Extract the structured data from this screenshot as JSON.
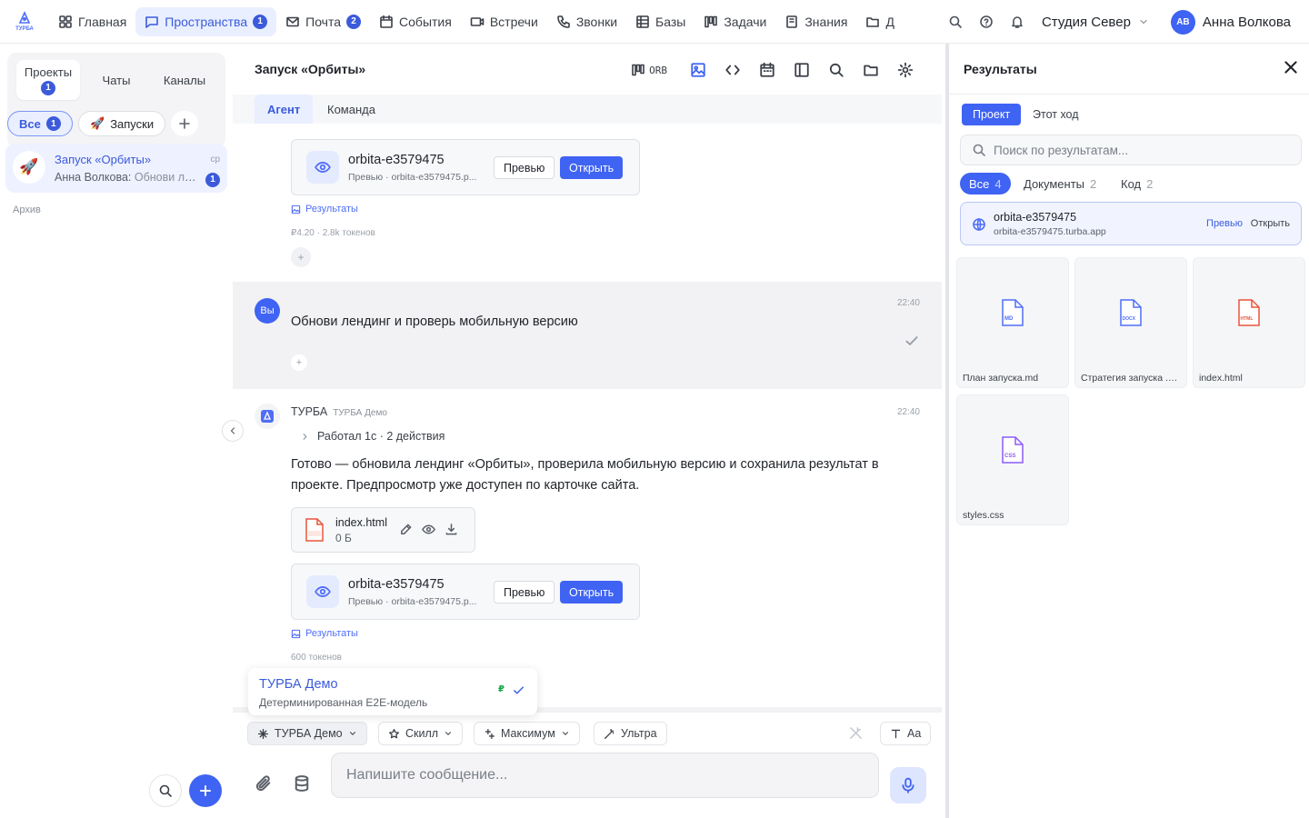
{
  "nav": {
    "logo_text": "ТУРБА",
    "items": [
      {
        "label": "Главная",
        "icon": "grid-icon"
      },
      {
        "label": "Пространства",
        "icon": "chat-icon",
        "badge": "1",
        "active": true
      },
      {
        "label": "Почта",
        "icon": "mail-icon",
        "badge": "2"
      },
      {
        "label": "События",
        "icon": "calendar-icon"
      },
      {
        "label": "Встречи",
        "icon": "video-icon"
      },
      {
        "label": "Звонки",
        "icon": "phone-icon"
      },
      {
        "label": "Базы",
        "icon": "table-icon"
      },
      {
        "label": "Задачи",
        "icon": "kanban-icon"
      },
      {
        "label": "Знания",
        "icon": "book-icon"
      },
      {
        "label": "Д",
        "icon": "folder-icon"
      }
    ],
    "workspace": "Студия Север",
    "user_initials": "АВ",
    "user_name": "Анна Волкова"
  },
  "sidebar": {
    "tabs": [
      {
        "label": "Проекты",
        "badge": "1"
      },
      {
        "label": "Чаты"
      },
      {
        "label": "Каналы"
      }
    ],
    "filters": {
      "all": "Все",
      "all_badge": "1",
      "launches": "Запуски",
      "launch_emoji": "🚀"
    },
    "project": {
      "emoji": "🚀",
      "title": "Запуск «Орбиты»",
      "author": "Анна Волкова:",
      "preview": "Обнови лендинг и проверь мобильную версию",
      "day": "ср",
      "badge": "1"
    },
    "archive": "Архив"
  },
  "main": {
    "title": "Запуск «Орбиты»",
    "orb_label": "ORB",
    "tabs": [
      "Агент",
      "Команда"
    ],
    "card_top": {
      "name": "orbita-e3579475",
      "sub": "Превью · orbita-e3579475.p...",
      "preview": "Превью",
      "open": "Открыть"
    },
    "results_link": "Результаты",
    "meta_top": "₽4.20 · 2.8k токенов",
    "user_msg": {
      "avatar": "Вы",
      "text": "Обнови лендинг и проверь мобильную версию",
      "time": "22:40"
    },
    "bot_msg": {
      "name": "ТУРБА",
      "model": "ТУРБА Демо",
      "time": "22:40",
      "worked": "Работал 1с · 2 действия",
      "text": "Готово — обновила лендинг «Орбиты», проверила мобильную версию и сохранила результат в проекте. Предпросмотр уже доступен по карточке сайта.",
      "file": {
        "name": "index.html",
        "size": "0 Б"
      },
      "card": {
        "name": "orbita-e3579475",
        "sub": "Превью · orbita-e3579475.p...",
        "preview": "Превью",
        "open": "Открыть"
      },
      "results_link": "Результаты",
      "meta": "600 токенов"
    },
    "model_popup": {
      "title": "ТУРБА Демо",
      "subtitle": "Детерминированная E2E-модель",
      "price_symbol": "₽"
    },
    "composer": {
      "model": "ТУРБА Демо",
      "skill": "Скилл",
      "max": "Максимум",
      "ultra": "Ультра",
      "font": "Aa",
      "placeholder": "Напишите сообщение..."
    }
  },
  "results": {
    "title": "Результаты",
    "tabs": [
      "Проект",
      "Этот ход"
    ],
    "search_placeholder": "Поиск по результатам...",
    "filters": [
      {
        "label": "Все",
        "count": "4"
      },
      {
        "label": "Документы",
        "count": "2"
      },
      {
        "label": "Код",
        "count": "2"
      }
    ],
    "site": {
      "name": "orbita-e3579475",
      "url": "orbita-e3579475.turba.app",
      "preview": "Превью",
      "open": "Открыть"
    },
    "files": [
      {
        "name": "План запуска.md",
        "ext": "MD",
        "color": "#4f6ef7"
      },
      {
        "name": "Стратегия запуска .docx",
        "ext": "DOCX",
        "color": "#4f6ef7"
      },
      {
        "name": "index.html",
        "ext": "HTML",
        "color": "#e8553d"
      },
      {
        "name": "styles.css",
        "ext": "CSS",
        "color": "#8b5cf6"
      }
    ]
  }
}
